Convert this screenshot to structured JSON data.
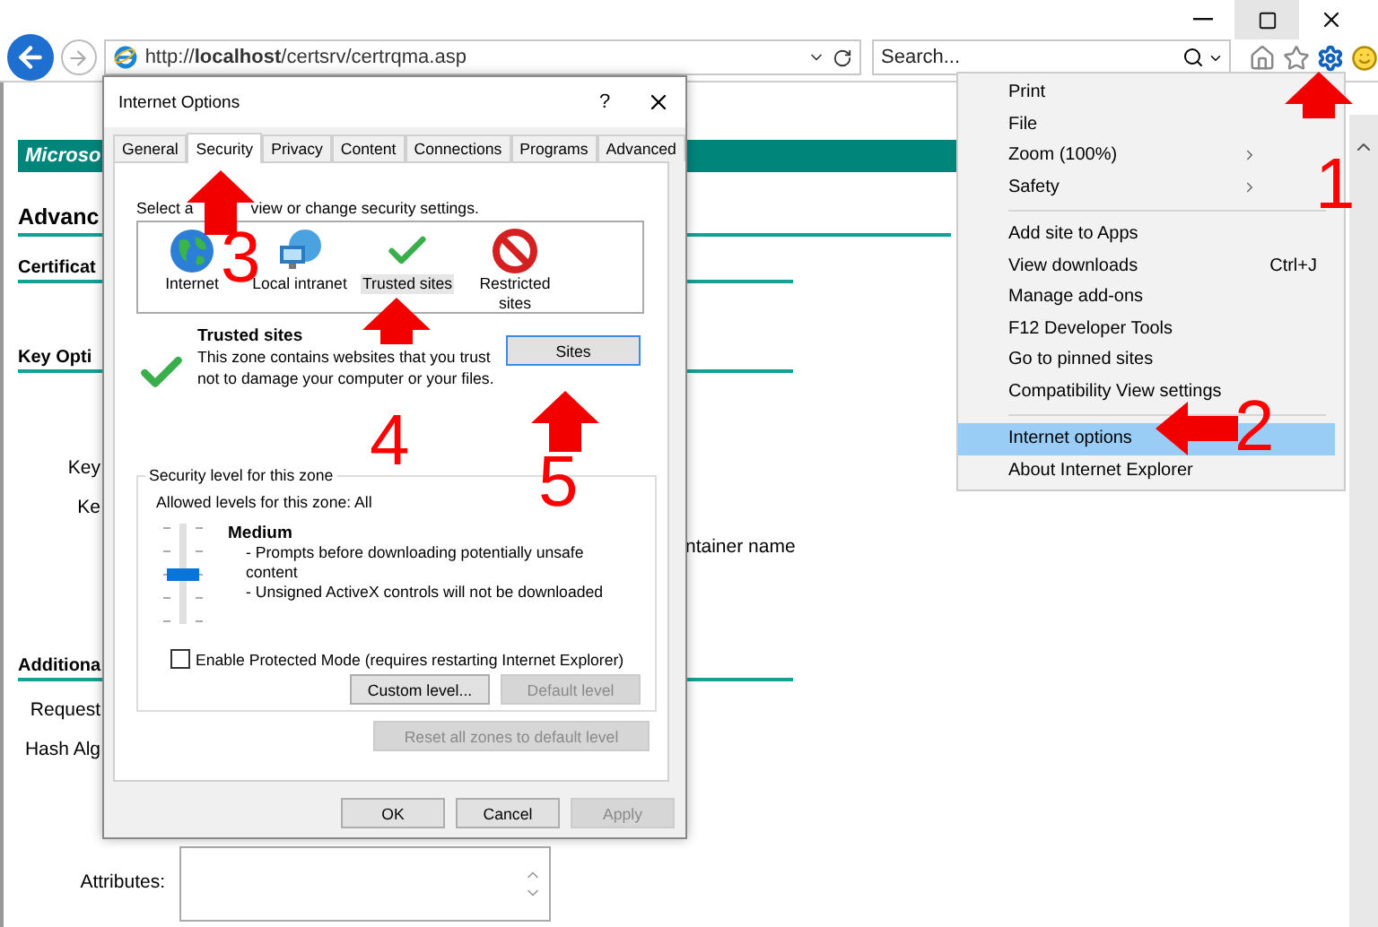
{
  "window_buttons": [
    {
      "kind": "minimize",
      "highlighted": false
    },
    {
      "kind": "maximize",
      "highlighted": true
    },
    {
      "kind": "close",
      "highlighted": false
    }
  ],
  "toolbar": {
    "address": "http://**localhost**/certsrv/certrqma.asp",
    "search_placeholder": "Search..."
  },
  "page": {
    "banner": "Microso",
    "rows": [
      {
        "kind": "title",
        "text": "Advanc"
      },
      {
        "kind": "heading",
        "text": "Certificat"
      },
      {
        "kind": "heading",
        "text": "Key Opti"
      },
      {
        "kind": "label",
        "text": "Key"
      },
      {
        "kind": "label",
        "text": "Ke"
      },
      {
        "kind": "side",
        "text": "ntainer name"
      },
      {
        "kind": "heading",
        "text": "Additiona"
      },
      {
        "kind": "label",
        "text": "Request"
      },
      {
        "kind": "label",
        "text": "Hash Alg"
      },
      {
        "kind": "area",
        "text": "Attributes:"
      }
    ]
  },
  "dialog": {
    "title": "Internet Options",
    "help": "?",
    "tabs": [
      {
        "label": "General",
        "selected": false
      },
      {
        "label": "Security",
        "selected": true
      },
      {
        "label": "Privacy",
        "selected": false
      },
      {
        "label": "Content",
        "selected": false
      },
      {
        "label": "Connections",
        "selected": false
      },
      {
        "label": "Programs",
        "selected": false
      },
      {
        "label": "Advanced",
        "selected": false
      }
    ],
    "prompt_parts": [
      "Select a",
      "view or change security settings."
    ],
    "zones": [
      {
        "kind": "internet",
        "label": "Internet",
        "selected": false
      },
      {
        "kind": "intranet",
        "label": "Local intranet",
        "selected": false
      },
      {
        "kind": "trusted",
        "label": "Trusted sites",
        "selected": true
      },
      {
        "kind": "restricted",
        "label": "Restricted sites",
        "selected": false
      }
    ],
    "zone_title": "Trusted sites",
    "zone_description": "This zone contains websites that you trust not to damage your computer or your files.",
    "sites_button": "Sites",
    "group_title": "Security level for this zone",
    "allowed": "Allowed levels for this zone: All",
    "slider": {
      "level": 0.5
    },
    "level_name": "Medium",
    "level_points": [
      "- Prompts before downloading potentially unsafe content",
      "- Unsigned ActiveX controls will not be downloaded"
    ],
    "protected_mode": {
      "label": "Enable Protected Mode (requires restarting Internet Explorer)",
      "checked": false
    },
    "level_buttons": [
      {
        "label": "Custom level...",
        "disabled": false
      },
      {
        "label": "Default level",
        "disabled": true
      }
    ],
    "reset_button": {
      "label": "Reset all zones to default level",
      "disabled": true
    },
    "buttons": [
      {
        "label": "OK",
        "disabled": false
      },
      {
        "label": "Cancel",
        "disabled": false
      },
      {
        "label": "Apply",
        "disabled": true
      }
    ]
  },
  "menu": {
    "groups": [
      [
        {
          "label": "Print",
          "selected": false
        },
        {
          "label": "File",
          "selected": false
        },
        {
          "label": "Zoom (100%)",
          "submenu": true,
          "selected": false
        },
        {
          "label": "Safety",
          "submenu": true,
          "selected": false
        }
      ],
      [
        {
          "label": "Add site to Apps",
          "selected": false
        },
        {
          "label": "View downloads",
          "shortcut": "Ctrl+J",
          "selected": false
        },
        {
          "label": "Manage add-ons",
          "selected": false
        },
        {
          "label": "F12 Developer Tools",
          "selected": false
        },
        {
          "label": "Go to pinned sites",
          "selected": false
        },
        {
          "label": "Compatibility View settings",
          "selected": false
        }
      ],
      [
        {
          "label": "Internet options",
          "selected": true
        },
        {
          "label": "About Internet Explorer",
          "selected": false
        }
      ]
    ]
  },
  "annotations": [
    {
      "label": "1",
      "kind": "up"
    },
    {
      "label": "2",
      "kind": "left"
    },
    {
      "label": "3",
      "kind": "up"
    },
    {
      "label": "4",
      "kind": "up"
    },
    {
      "label": "5",
      "kind": "up"
    }
  ]
}
